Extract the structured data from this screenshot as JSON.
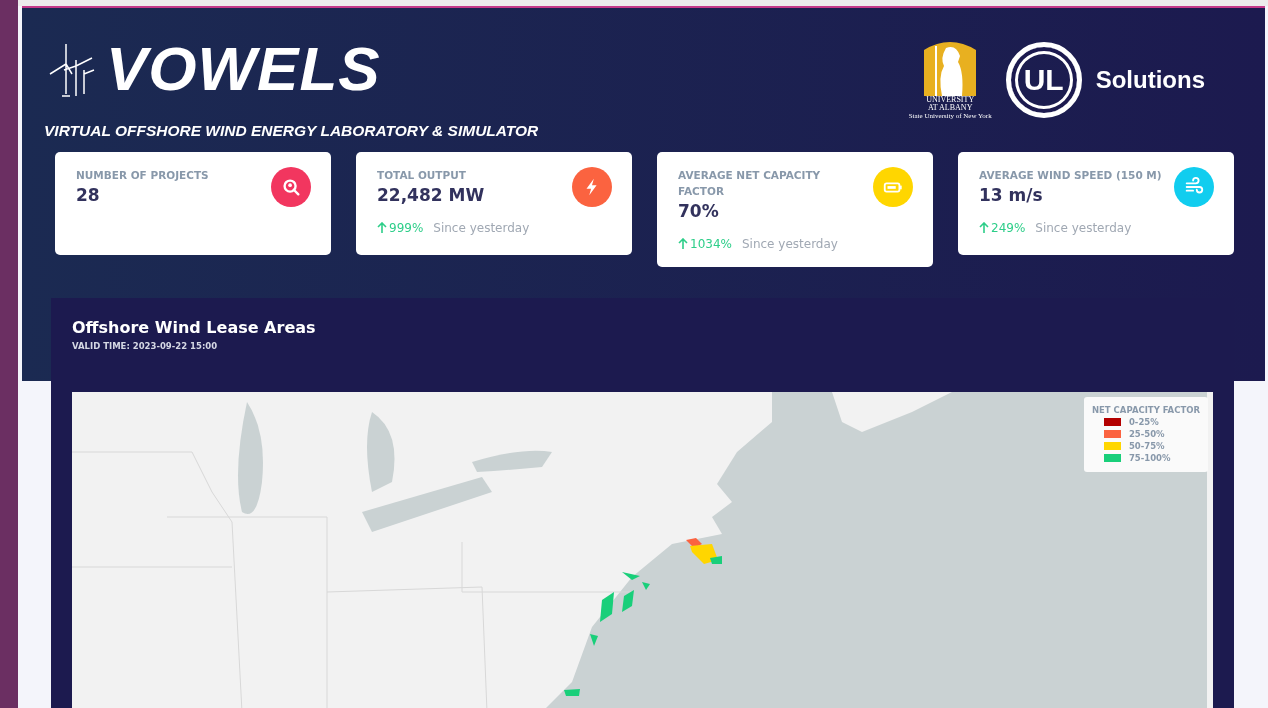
{
  "brand": {
    "title": "VOWELS",
    "subtitle": "VIRTUAL OFFSHORE WIND ENERGY LABORATORY & SIMULATOR"
  },
  "partners": {
    "university": {
      "line1": "UNIVERSITY",
      "line2": "AT ALBANY",
      "line3": "State University of New York"
    },
    "ul": {
      "mark": "UL",
      "name": "Solutions"
    }
  },
  "stats": [
    {
      "label": "NUMBER OF PROJECTS",
      "value": "28",
      "color": "#f2365f"
    },
    {
      "label": "TOTAL OUTPUT",
      "value": "22,482 MW",
      "change": "999%",
      "note": "Since yesterday",
      "color": "#fb6340"
    },
    {
      "label": "AVERAGE NET CAPACITY FACTOR",
      "value": "70%",
      "change": "1034%",
      "note": "Since yesterday",
      "color": "#ffd600"
    },
    {
      "label": "AVERAGE WIND SPEED (150 M)",
      "value": "13 m/s",
      "change": "249%",
      "note": "Since yesterday",
      "color": "#11cdef"
    }
  ],
  "map": {
    "title": "Offshore Wind Lease Areas",
    "valid_time": "VALID TIME: 2023-09-22 15:00",
    "legend": {
      "title": "NET CAPACITY FACTOR",
      "items": [
        {
          "label": "0-25%",
          "color": "#b30000"
        },
        {
          "label": "25-50%",
          "color": "#fb6340"
        },
        {
          "label": "50-75%",
          "color": "#ffd600"
        },
        {
          "label": "75-100%",
          "color": "#19cf7a"
        }
      ]
    }
  }
}
